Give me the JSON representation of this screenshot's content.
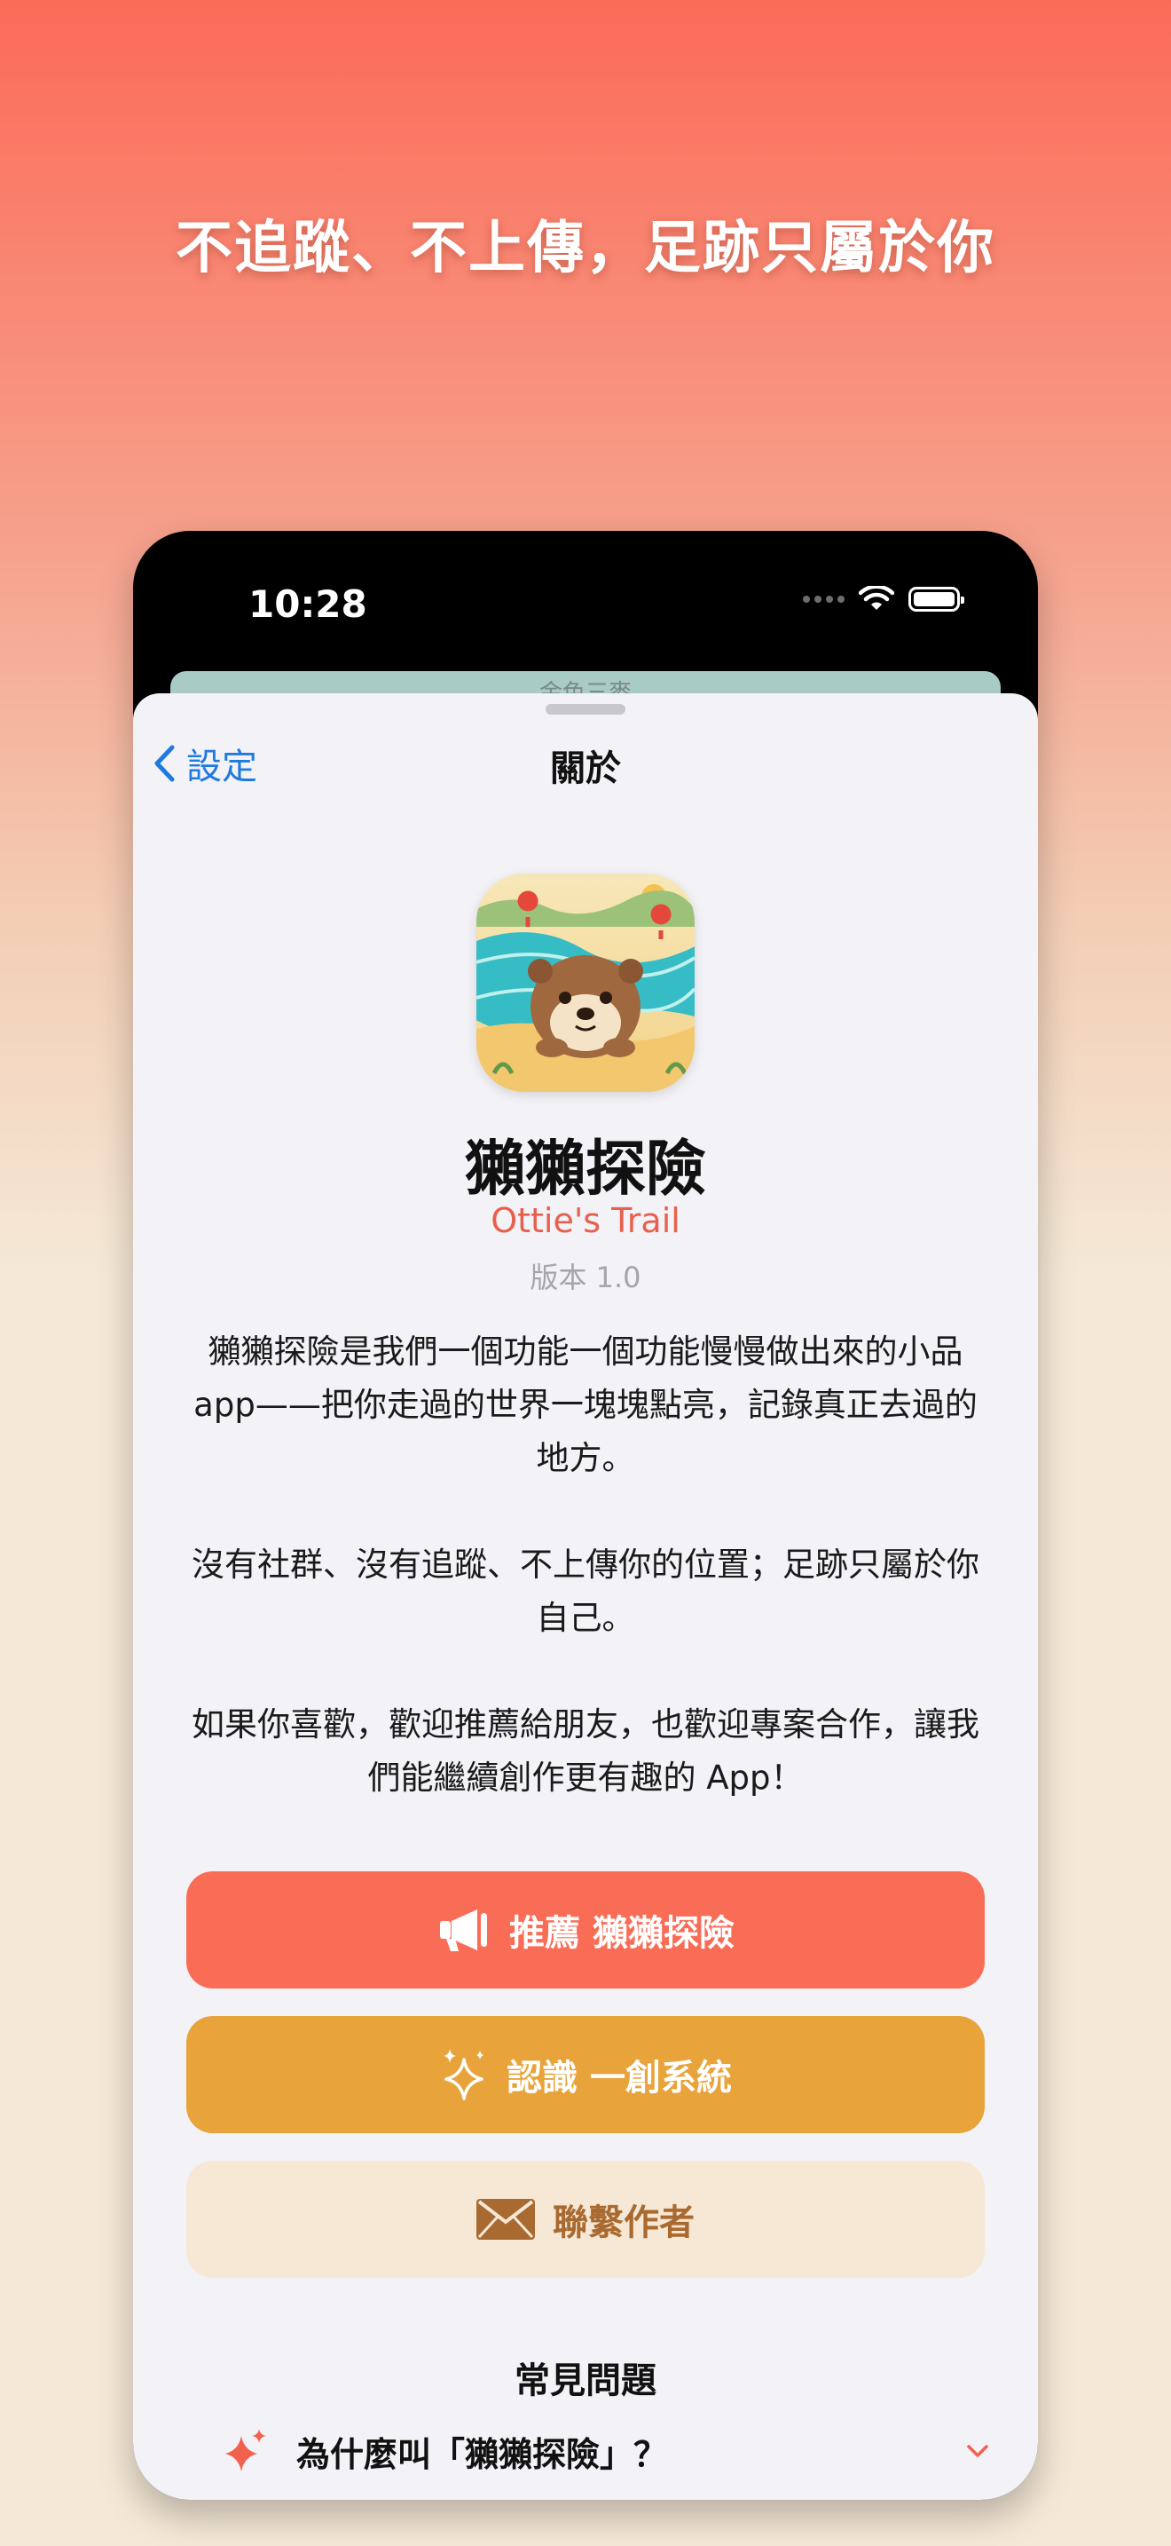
{
  "headline": "不追蹤、不上傳，足跡只屬於你",
  "status_bar": {
    "time": "10:28"
  },
  "behind_card": {
    "text": "金色三麥"
  },
  "nav": {
    "back_label": "設定",
    "title": "關於"
  },
  "app": {
    "name": "獺獺探險",
    "subtitle": "Ottie's Trail",
    "version": "版本 1.0"
  },
  "description": [
    "獺獺探險是我們一個功能一個功能慢慢做出來的小品 app——把你走過的世界一塊塊點亮，記錄真正去過的地方。",
    "沒有社群、沒有追蹤、不上傳你的位置；足跡只屬於你自己。",
    "如果你喜歡，歡迎推薦給朋友，也歡迎專案合作，讓我們能繼續創作更有趣的 App！"
  ],
  "buttons": {
    "recommend": "推薦 獺獺探險",
    "know": "認識 一創系統",
    "contact": "聯繫作者"
  },
  "faq": {
    "title": "常見問題",
    "items": [
      {
        "question": "為什麼叫「獺獺探險」？"
      }
    ]
  },
  "colors": {
    "accent_red": "#f96d57",
    "accent_orange": "#e8a33a",
    "accent_cream": "#f6e8d5",
    "link_blue": "#1f7ae0"
  },
  "icons": {
    "back": "chevron-left-icon",
    "recommend": "megaphone-icon",
    "know": "sparkles-icon",
    "contact": "envelope-icon",
    "faq_item": "sparkles-icon",
    "faq_toggle": "chevron-down-icon"
  }
}
